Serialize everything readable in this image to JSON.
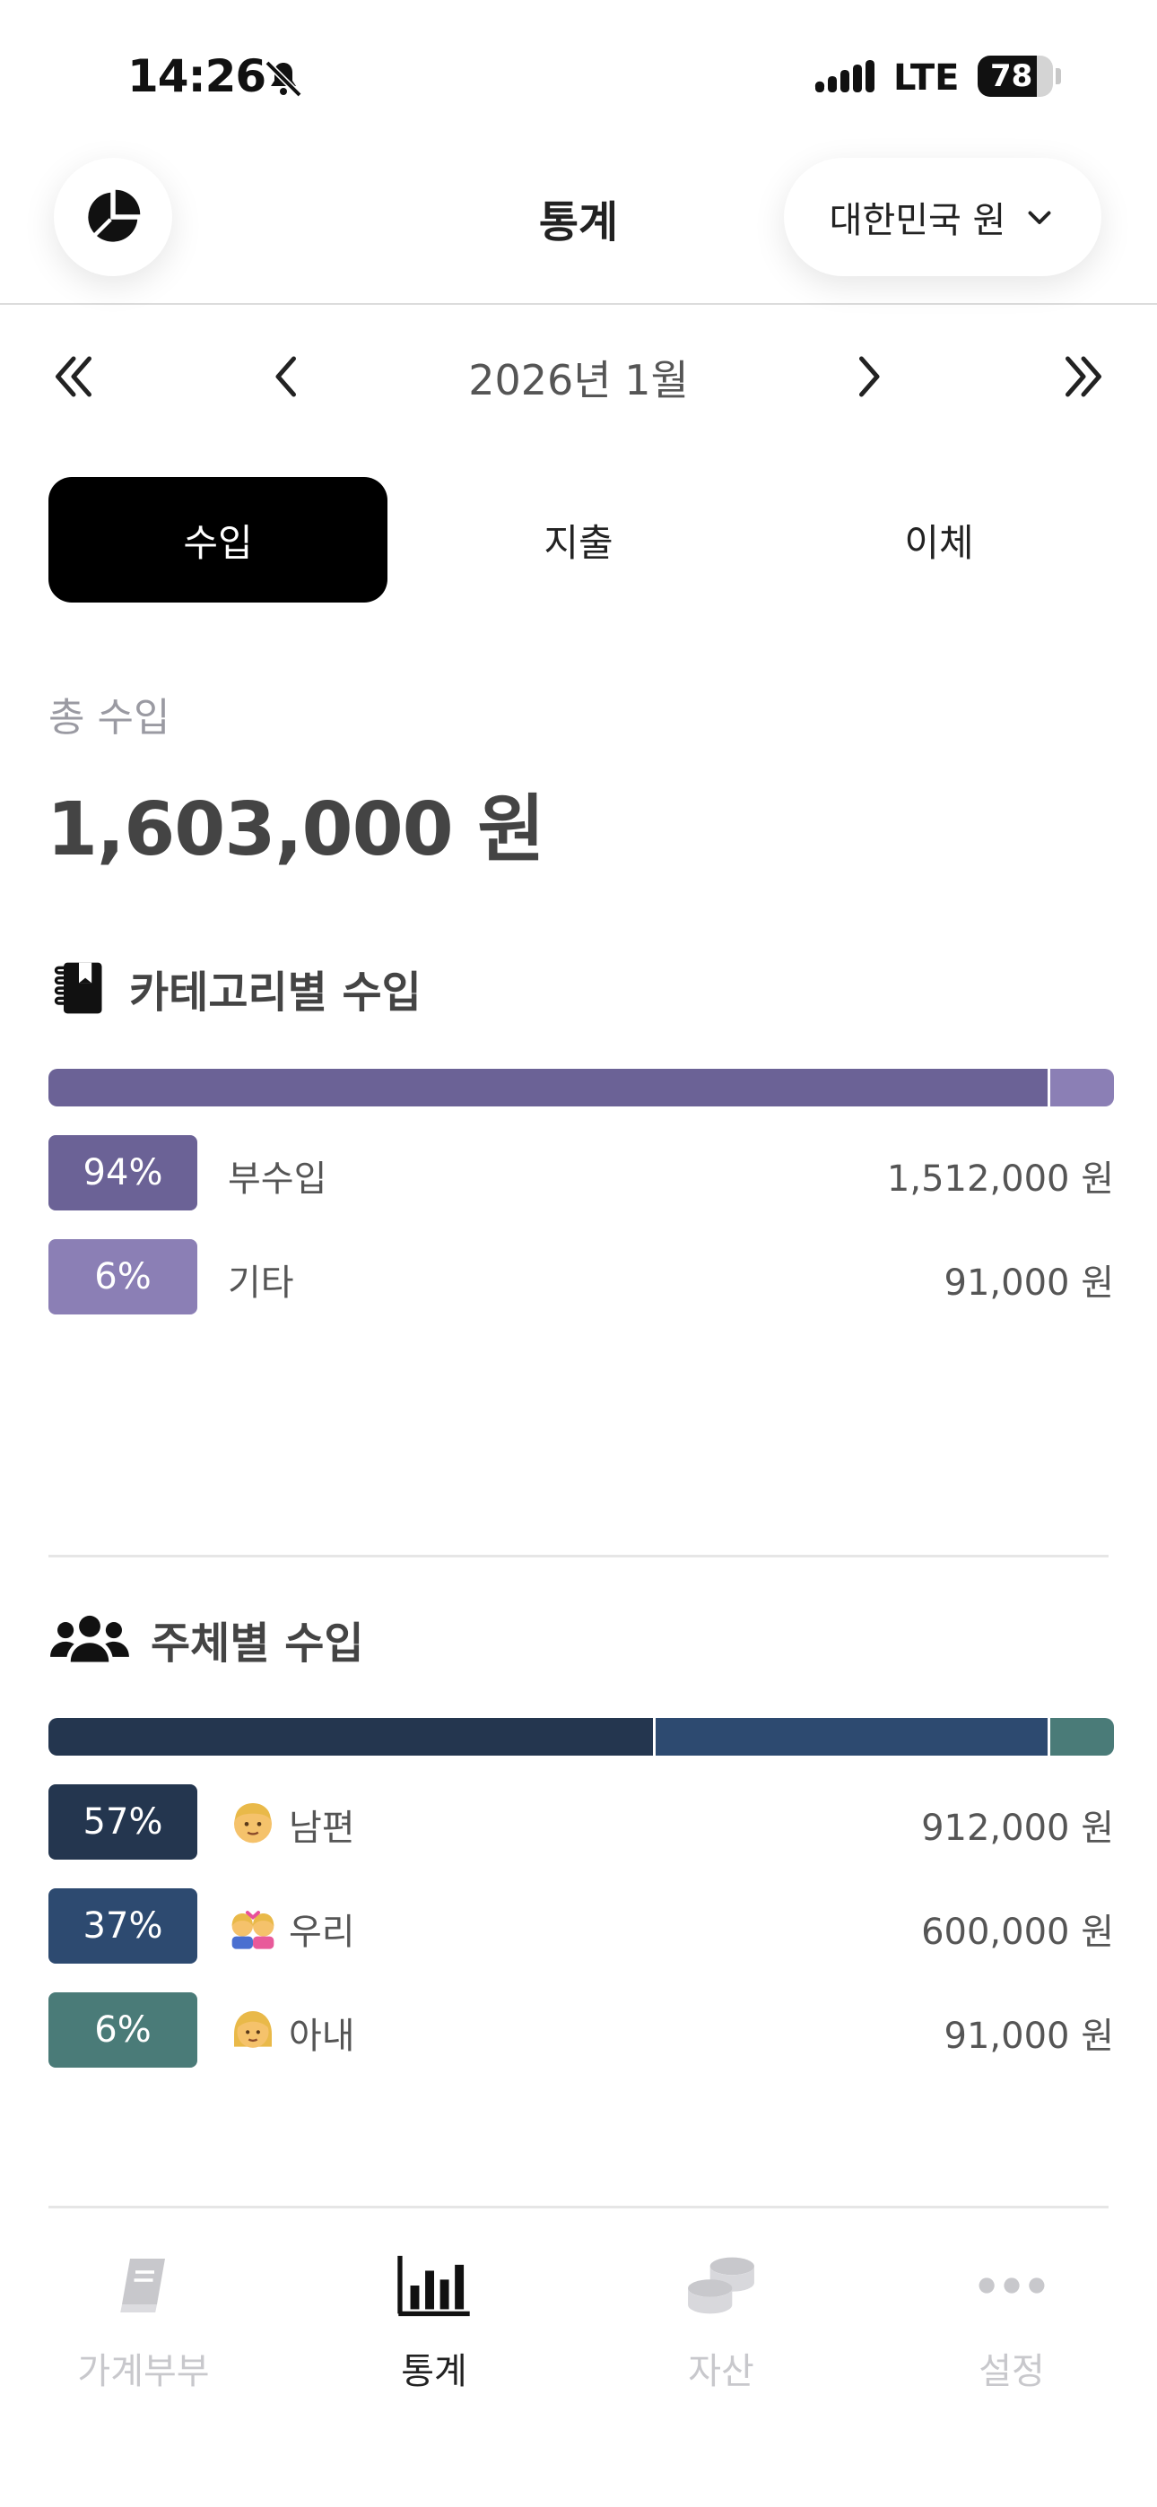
{
  "status": {
    "time": "14:26",
    "network": "LTE",
    "battery": "78"
  },
  "header": {
    "title": "통계",
    "currency": "대한민국 원"
  },
  "month_nav": {
    "label": "2026년 1월"
  },
  "tabs": [
    {
      "label": "수입",
      "active": true
    },
    {
      "label": "지출",
      "active": false
    },
    {
      "label": "이체",
      "active": false
    }
  ],
  "total": {
    "label": "총 수입",
    "value": "1,603,000 원"
  },
  "category_section": {
    "title": "카테고리별 수입",
    "items": [
      {
        "percent": "94%",
        "name": "부수입",
        "amount": "1,512,000 원",
        "share": 0.94,
        "color": "#6b6296"
      },
      {
        "percent": "6%",
        "name": "기타",
        "amount": "91,000 원",
        "share": 0.06,
        "color": "#8b7fb5"
      }
    ]
  },
  "member_section": {
    "title": "주체별 수입",
    "items": [
      {
        "percent": "57%",
        "emoji": "man-icon",
        "name": "남편",
        "amount": "912,000 원",
        "share": 0.57,
        "color": "#24364f"
      },
      {
        "percent": "37%",
        "emoji": "couple-icon",
        "name": "우리",
        "amount": "600,000 원",
        "share": 0.37,
        "color": "#2d4a70"
      },
      {
        "percent": "6%",
        "emoji": "woman-icon",
        "name": "아내",
        "amount": "91,000 원",
        "share": 0.06,
        "color": "#4a7b78"
      }
    ]
  },
  "bottom_nav": [
    {
      "label": "가계부부",
      "icon": "book-icon",
      "active": false
    },
    {
      "label": "통계",
      "icon": "bar-chart-icon",
      "active": true
    },
    {
      "label": "자산",
      "icon": "coins-icon",
      "active": false
    },
    {
      "label": "설정",
      "icon": "more-icon",
      "active": false
    }
  ]
}
